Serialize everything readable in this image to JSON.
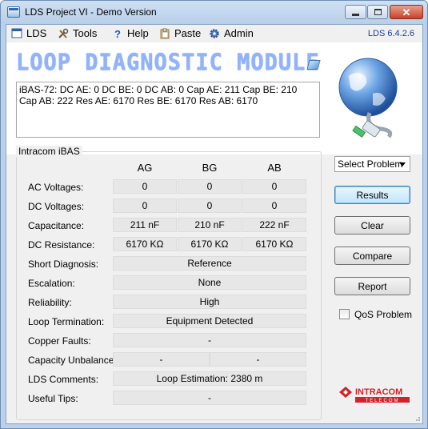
{
  "window": {
    "title": "LDS Project VI - Demo Version",
    "minimize_icon": "minimize-icon",
    "maximize_icon": "maximize-icon",
    "close_icon": "close-icon"
  },
  "menu": {
    "items": [
      {
        "label": "LDS",
        "icon": "window-icon"
      },
      {
        "label": "Tools",
        "icon": "tools-icon"
      },
      {
        "label": "Help",
        "icon": "help-icon"
      },
      {
        "label": "Paste",
        "icon": "clipboard-icon"
      },
      {
        "label": "Admin",
        "icon": "gear-icon"
      }
    ],
    "version": "LDS 6.4.2.6"
  },
  "header": {
    "banner": "LOOP DIAGNOSTIC MODULE",
    "status_text": "iBAS-72: DC AE: 0 DC BE: 0 DC AB: 0 Cap AE: 211 Cap BE: 210 Cap AB: 222 Res AE: 6170 Res BE: 6170 Res AB: 6170"
  },
  "panel": {
    "title": "Intracom iBAS",
    "columns": [
      "AG",
      "BG",
      "AB"
    ],
    "rows": [
      {
        "label": "AC Voltages:",
        "values": [
          "0",
          "0",
          "0"
        ]
      },
      {
        "label": "DC Voltages:",
        "values": [
          "0",
          "0",
          "0"
        ]
      },
      {
        "label": "Capacitance:",
        "values": [
          "211 nF",
          "210 nF",
          "222 nF"
        ]
      },
      {
        "label": "DC Resistance:",
        "values": [
          "6170 KΩ",
          "6170 KΩ",
          "6170 KΩ"
        ]
      }
    ],
    "short_diagnosis": {
      "label": "Short Diagnosis:",
      "value": "Reference"
    },
    "escalation": {
      "label": "Escalation:",
      "value": "None"
    },
    "reliability": {
      "label": "Reliability:",
      "value": "High"
    },
    "loop_termination": {
      "label": "Loop Termination:",
      "value": "Equipment Detected"
    },
    "copper_faults": {
      "label": "Copper Faults:",
      "value": "-"
    },
    "capacity_unbalance": {
      "label": "Capacity Unbalance:",
      "values": [
        "-",
        "-"
      ]
    },
    "lds_comments": {
      "label": "LDS Comments:",
      "value": "Loop Estimation: 2380 m"
    },
    "useful_tips": {
      "label": "Useful Tips:",
      "value": "-"
    }
  },
  "actions": {
    "select_problem": "Select Problem",
    "results": "Results",
    "clear": "Clear",
    "compare": "Compare",
    "report": "Report",
    "qos_label": "QoS Problem",
    "qos_checked": false
  },
  "logo": {
    "text": "INTRACOM",
    "subtext": "TELECOM",
    "color": "#d2232a"
  },
  "colors": {
    "banner": "#8fb3ff",
    "version": "#1a3e9a",
    "accent": "#3c7fb1"
  }
}
